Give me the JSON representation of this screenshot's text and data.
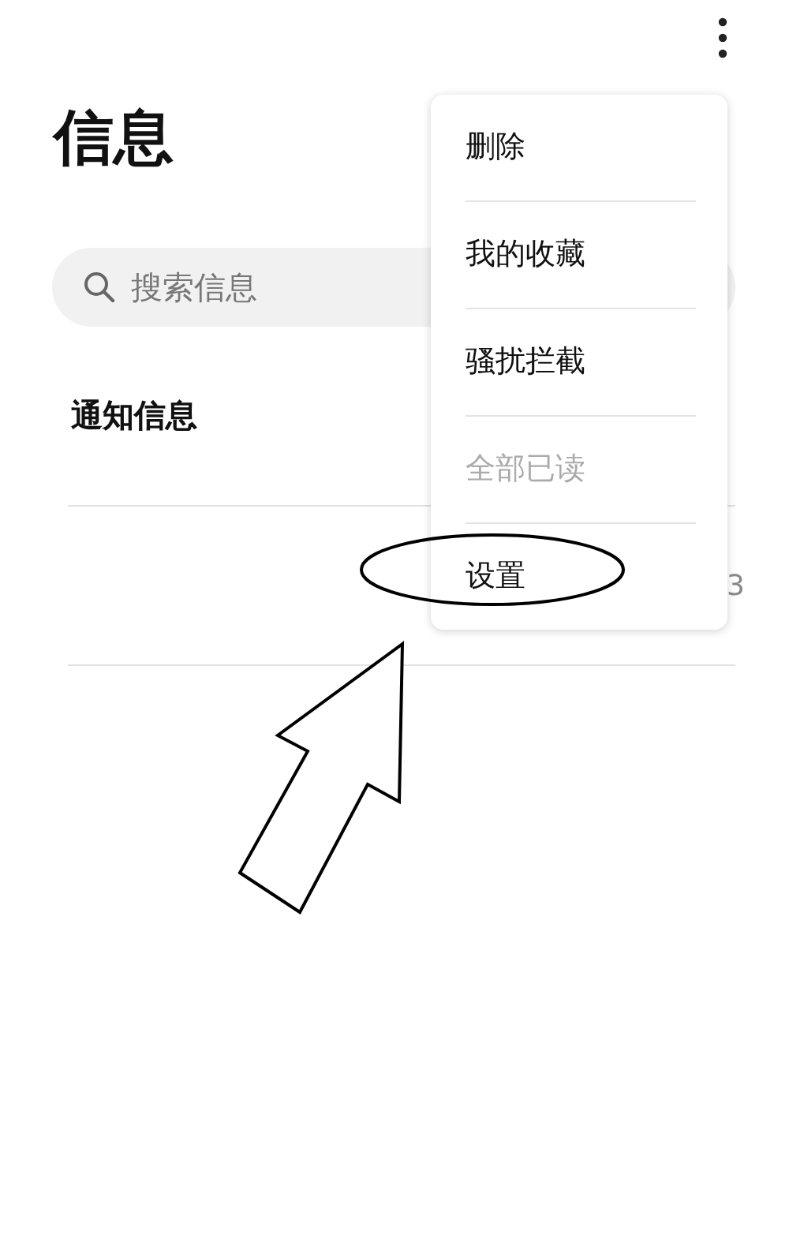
{
  "header": {
    "title": "信息"
  },
  "search": {
    "placeholder": "搜索信息"
  },
  "list": [
    {
      "label": "通知信息"
    },
    {
      "label": "3"
    }
  ],
  "menu": {
    "items": [
      {
        "label": "删除",
        "disabled": false
      },
      {
        "label": "我的收藏",
        "disabled": false
      },
      {
        "label": "骚扰拦截",
        "disabled": false
      },
      {
        "label": "全部已读",
        "disabled": true
      },
      {
        "label": "设置",
        "disabled": false
      }
    ]
  }
}
